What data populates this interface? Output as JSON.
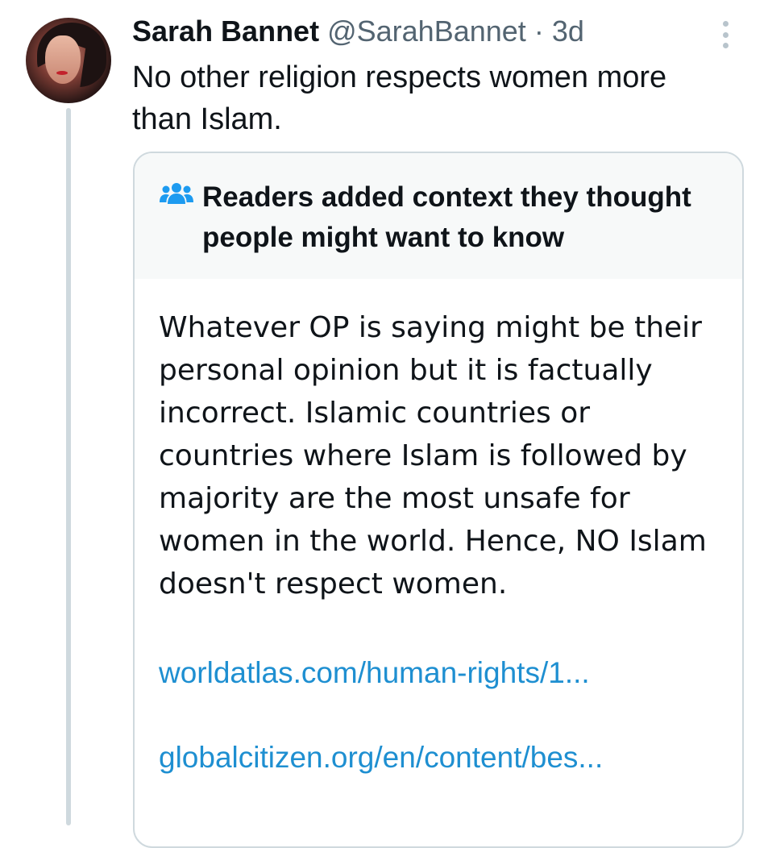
{
  "tweet": {
    "author_name": "Sarah Bannet",
    "author_handle": "@SarahBannet",
    "separator": " · ",
    "time": "3d",
    "text": "No other religion respects women more than Islam."
  },
  "community_note": {
    "icon": "people-icon",
    "title": "Readers added context they thought people might want to know",
    "body": "Whatever OP is saying might be their personal opinion but it is factually incorrect. Islamic countries or countries where Islam is followed by majority are the most unsafe for women in the world. Hence, NO Islam doesn't respect women.",
    "links": [
      "worldatlas.com/human-rights/1...",
      "globalcitizen.org/en/content/bes..."
    ]
  },
  "colors": {
    "link": "#1e8fd1",
    "note_header_bg": "#f7f9f9",
    "border": "#cfd9de",
    "secondary_text": "#536471"
  }
}
